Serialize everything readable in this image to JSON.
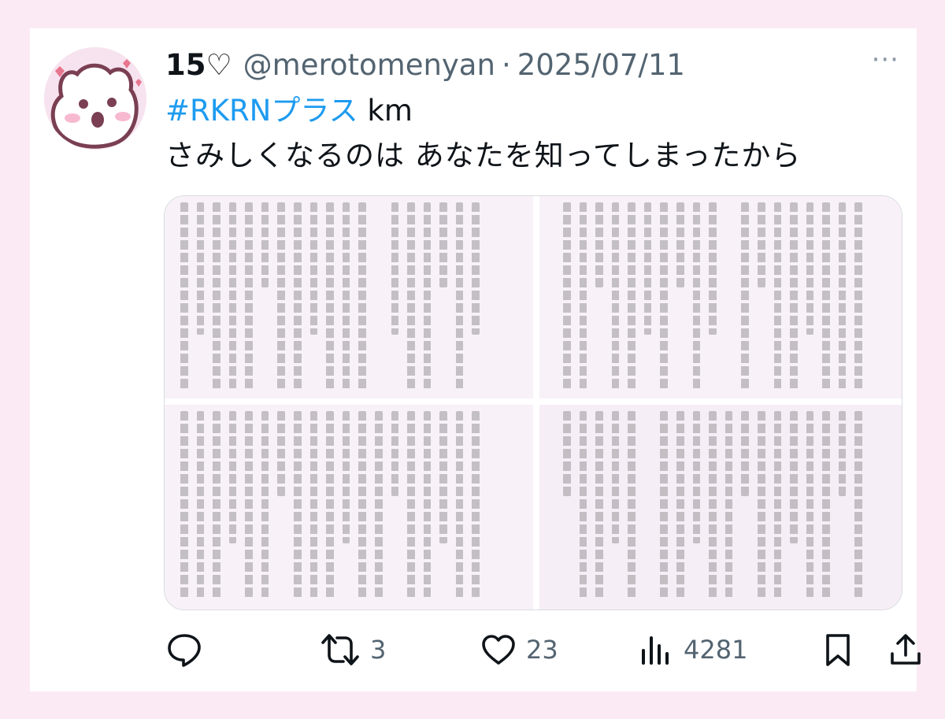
{
  "tweet": {
    "display_name": "15",
    "name_symbol": "♡",
    "handle": "@merotomenyan",
    "separator": "·",
    "date": "2025/07/11",
    "more": "···",
    "hashtag": "#RKRNプラス",
    "tag_suffix": " km",
    "body": "さみしくなるのは あなたを知ってしまったから"
  },
  "actions": {
    "reply_icon": "reply-icon",
    "retweet_icon": "retweet-icon",
    "retweet_count": "3",
    "like_icon": "heart-icon",
    "like_count": "23",
    "views_icon": "bar-chart-icon",
    "views_count": "4281",
    "bookmark_icon": "bookmark-icon",
    "share_icon": "share-icon"
  },
  "colors": {
    "page_bg": "#fbeaf4",
    "hashtag": "#1d9bf0",
    "muted": "#536471",
    "text": "#0f1419"
  }
}
